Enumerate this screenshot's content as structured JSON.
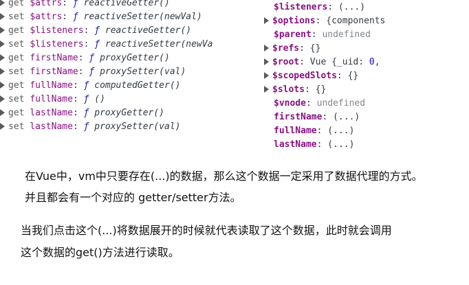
{
  "console_left": {
    "rows": [
      {
        "kind": "get",
        "name": "$attrs",
        "fn": "reactiveGetter()"
      },
      {
        "kind": "set",
        "name": "$attrs",
        "fn": "reactiveSetter(newVal)"
      },
      {
        "kind": "get",
        "name": "$listeners",
        "fn": "reactiveGetter()"
      },
      {
        "kind": "set",
        "name": "$listeners",
        "fn": "reactiveSetter(newVa"
      },
      {
        "kind": "get",
        "name": "firstName",
        "fn": "proxyGetter()"
      },
      {
        "kind": "set",
        "name": "firstName",
        "fn": "proxySetter(val)"
      },
      {
        "kind": "get",
        "name": "fullName",
        "fn": "computedGetter()"
      },
      {
        "kind": "set",
        "name": "fullName",
        "fn": "()"
      },
      {
        "kind": "get",
        "name": "lastName",
        "fn": "proxyGetter()"
      },
      {
        "kind": "set",
        "name": "lastName",
        "fn": "proxySetter(val)"
      }
    ],
    "colon": ":",
    "f_symbol": "ƒ"
  },
  "console_right": {
    "rows": [
      {
        "key": "$listeners",
        "value": "(...)"
      },
      {
        "key": "$options",
        "value": "{components"
      },
      {
        "key": "$parent",
        "value": "undefined"
      },
      {
        "key": "$refs",
        "value": "{}"
      },
      {
        "key": "$root",
        "value_prefix": "Vue {_uid: ",
        "value_num": "0",
        "value_suffix": ","
      },
      {
        "key": "$scopedSlots",
        "value": "{}"
      },
      {
        "key": "$slots",
        "value": "{}"
      },
      {
        "key": "$vnode",
        "value": "undefined"
      },
      {
        "key": "firstName",
        "value": "(...)"
      },
      {
        "key": "fullName",
        "value": "(...)"
      },
      {
        "key": "lastName",
        "value": "(...)"
      }
    ],
    "colon": ":"
  },
  "paragraphs": {
    "p1_line1": "在Vue中，vm中只要存在(...)的数据，那么这个数据一定采用了数据代理的方式。",
    "p1_line2": "并且都会有一个对应的 getter/setter方法。",
    "p2_line1": "当我们点击这个(...)将数据展开的时候就代表读取了这个数据，此时就会调用",
    "p2_line2": "这个数据的get()方法进行读取。"
  }
}
